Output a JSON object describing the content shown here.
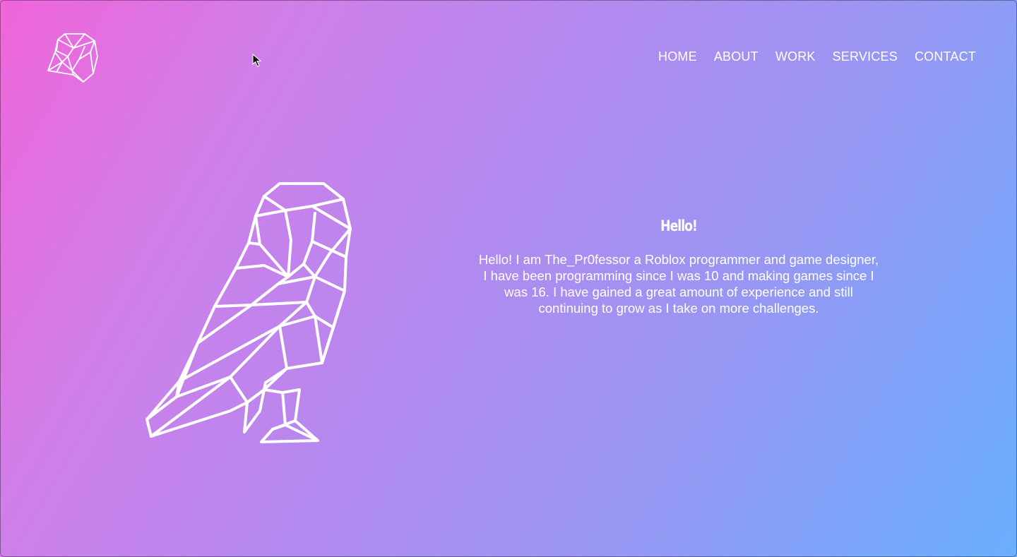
{
  "header": {
    "logo_icon": "owl-head-logo-icon",
    "nav": [
      {
        "label": "HOME"
      },
      {
        "label": "ABOUT"
      },
      {
        "label": "WORK"
      },
      {
        "label": "SERVICES"
      },
      {
        "label": "CONTACT"
      }
    ]
  },
  "hero": {
    "illustration_icon": "geometric-owl-icon",
    "heading": "Hello!",
    "body": "Hello! I am The_Pr0fessor a Roblox programmer and game designer, I have been programming since I was 10 and making games since I was 16. I have gained a great amount of experience and still continuing to grow as I take on more challenges."
  },
  "colors": {
    "gradient_start": "#f065d9",
    "gradient_end": "#6aaefc",
    "text": "#ffffff"
  }
}
